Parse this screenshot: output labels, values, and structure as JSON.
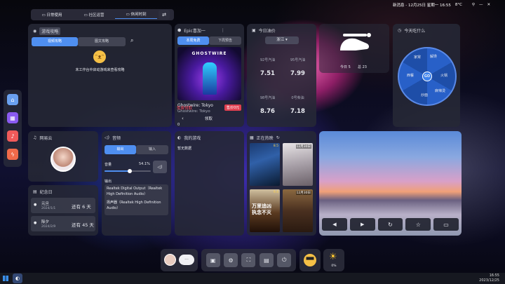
{
  "topbar": {
    "status": "新消息 - 12月25日 星期一 16:55 ",
    "temp": "8°C"
  },
  "tabs": [
    {
      "label": "日常使用"
    },
    {
      "label": "社区运营"
    },
    {
      "label": "休闲时刻"
    }
  ],
  "guide": {
    "title": "游戏攻略",
    "tab1": "视频攻略",
    "tab2": "图文攻略",
    "empty": "未工作台中启动游戏来查看攻略"
  },
  "epic": {
    "title": "Epic喜加一",
    "tab1": "本周免费",
    "tab2": "下周预告",
    "game": "Ghostwire: Tokyo",
    "game_sub": "Ghostwire: Tokyo",
    "count": "0",
    "free": "免费领取",
    "price": "售价0元",
    "receive": "领取",
    "cover_text": "GHOSTWIRE"
  },
  "oil": {
    "title": "今日油价",
    "region": "浙江",
    "items": [
      {
        "label": "92号汽油",
        "price": "7.51"
      },
      {
        "label": "95号汽油",
        "price": "7.99"
      },
      {
        "label": "98号汽油",
        "price": "8.76"
      },
      {
        "label": "0号柴油",
        "price": "7.18"
      }
    ]
  },
  "logo_widget": {
    "today": "今日 5",
    "total": "总 23"
  },
  "wheel": {
    "title": "今天吃什么",
    "go": "GO",
    "items": [
      "解馋",
      "火锅",
      "麻辣烫",
      "炒面",
      "西餐",
      "家常"
    ]
  },
  "music": {
    "title": "网易云"
  },
  "audio": {
    "title": "音频",
    "tab1": "输出",
    "tab2": "输入",
    "volume_label": "音量",
    "volume": "54.1%",
    "volume_value": 0.541,
    "output_label": "输出",
    "device1": "Realtek Digital Output（Realtek High Definition Audio）",
    "device2": "扬声器（Realtek High Definition Audio）"
  },
  "mygames": {
    "title": "我的游戏",
    "empty": "暂无数据"
  },
  "movies": {
    "title": "正在热映",
    "items": [
      {
        "score": "8.5",
        "date": "",
        "label": "影片海报"
      },
      {
        "score": "",
        "date": "12月30日",
        "label": "影片海报"
      },
      {
        "score": "9.4",
        "date": "",
        "label": "万里追凶 执念不灭"
      },
      {
        "score": "",
        "date": "12月30日",
        "label": "影片海报"
      }
    ]
  },
  "memorial": {
    "title": "纪念日",
    "items": [
      {
        "name": "元旦",
        "date": "2024/1/1",
        "remain": "还有 6 天"
      },
      {
        "name": "除夕",
        "date": "2024/2/9",
        "remain": "还有 45 天"
      }
    ]
  },
  "dock": {
    "battery": "0%"
  },
  "clock": {
    "time": "16:55",
    "date": "2023/12/25"
  },
  "colors": {
    "accent": "#4f8ff0",
    "price_red": "#ff4d5e",
    "go": "#3f83ee"
  }
}
